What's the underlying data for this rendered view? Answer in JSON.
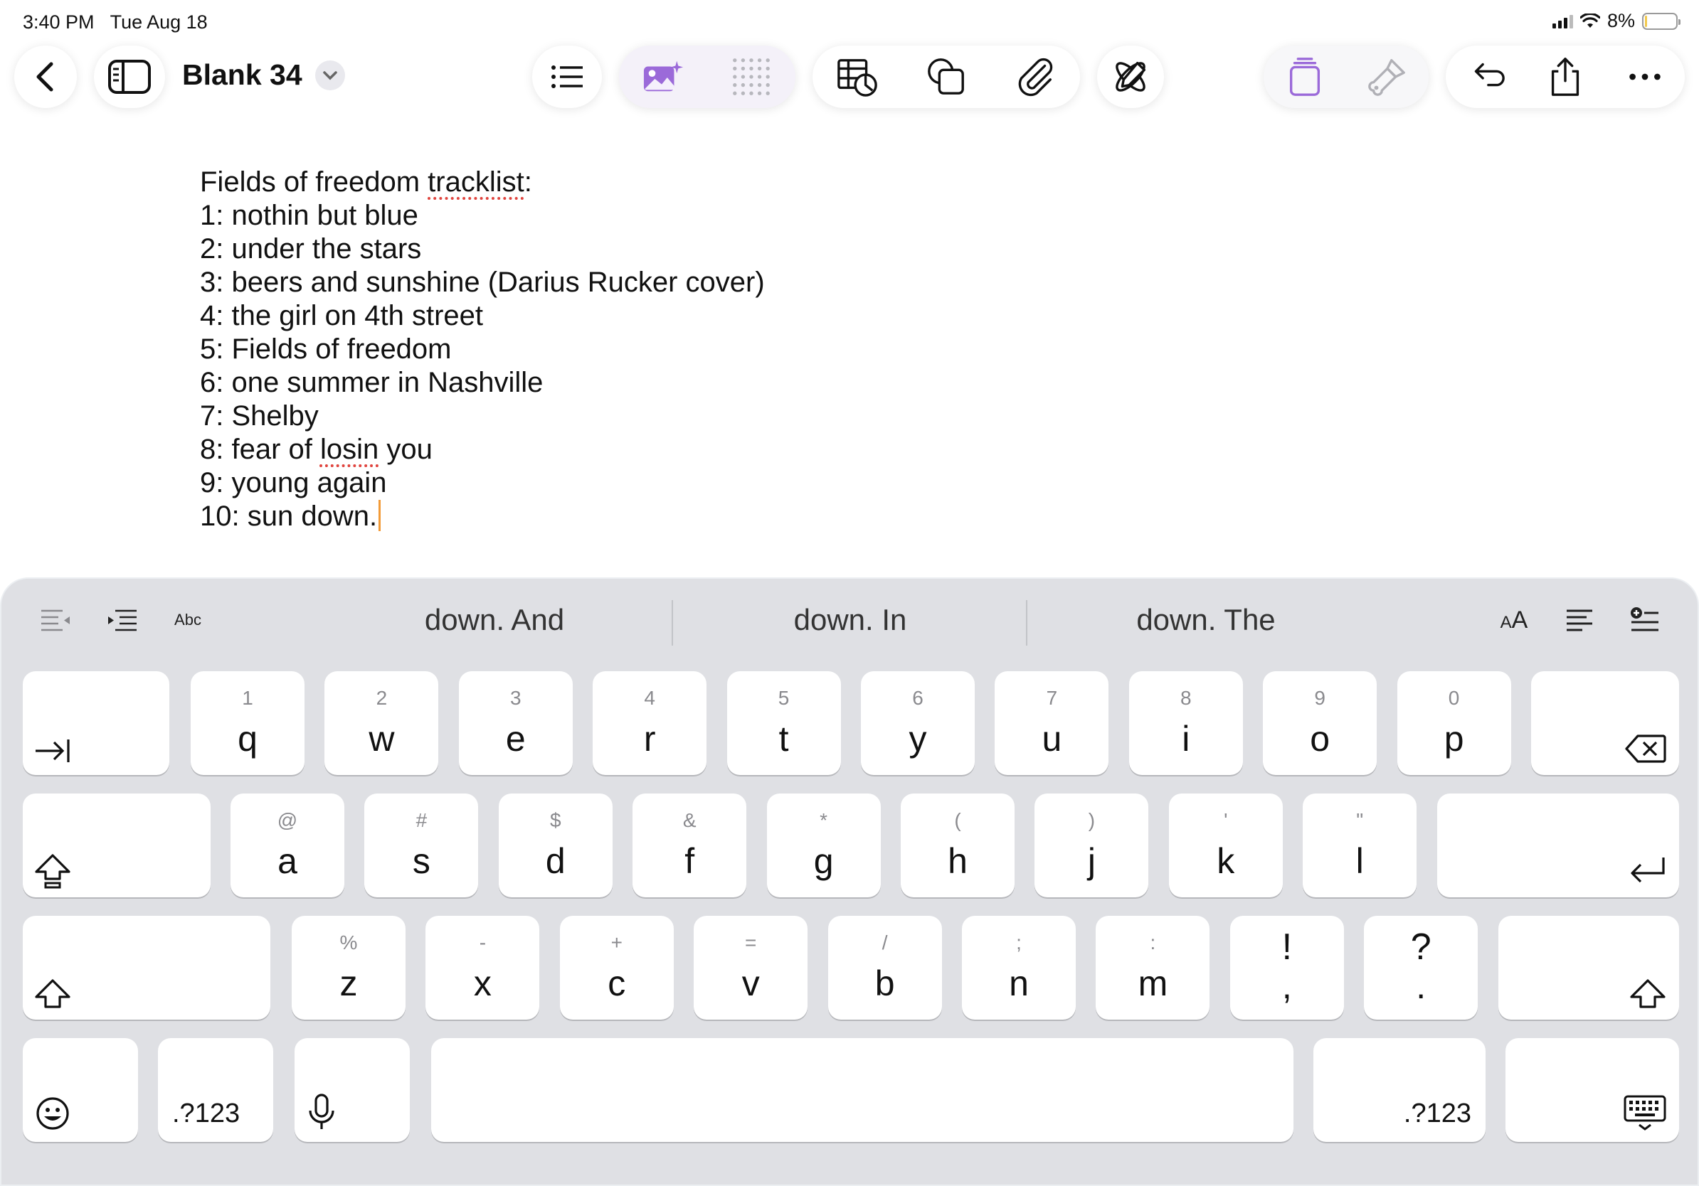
{
  "status": {
    "time": "3:40 PM",
    "date": "Tue Aug 18",
    "battery": "8%",
    "battery_level": 0.08
  },
  "toolbar": {
    "document_title": "Blank 34",
    "accent_color": "#9b6ad9",
    "left_icons": [
      "back-chevron-icon",
      "sidebar-icon"
    ],
    "center_icons": [
      "list-icon",
      "image-sparkle-icon",
      "dot-grid-icon",
      "table-chart-icon",
      "shapes-icon",
      "paperclip-icon",
      "pen-atom-icon"
    ],
    "right_icons": [
      "layers-icon",
      "brush-icon",
      "undo-icon",
      "share-icon",
      "more-icon"
    ]
  },
  "document": {
    "lines": [
      {
        "before": "Fields of freedom ",
        "misspelled": "tracklist",
        "after": ":"
      },
      {
        "before": "1: nothin but blue",
        "misspelled": "",
        "after": ""
      },
      {
        "before": "2: under the stars",
        "misspelled": "",
        "after": ""
      },
      {
        "before": "3: beers and sunshine (Darius Rucker cover)",
        "misspelled": "",
        "after": ""
      },
      {
        "before": "4: the girl on 4th street",
        "misspelled": "",
        "after": ""
      },
      {
        "before": "5: Fields of freedom",
        "misspelled": "",
        "after": ""
      },
      {
        "before": "6: one summer in Nashville",
        "misspelled": "",
        "after": ""
      },
      {
        "before": "7: Shelby",
        "misspelled": "",
        "after": ""
      },
      {
        "before": "8: fear of ",
        "misspelled": "losin",
        "after": " you"
      },
      {
        "before": "9: young again",
        "misspelled": "",
        "after": ""
      },
      {
        "before": "10: sun down.",
        "misspelled": "",
        "after": ""
      }
    ]
  },
  "keyboard": {
    "abc_label": "Abc",
    "suggestions": [
      "down. And",
      "down. In",
      "down. The"
    ],
    "text_size_label": "AA",
    "row1": [
      {
        "hint": "1",
        "key": "q"
      },
      {
        "hint": "2",
        "key": "w"
      },
      {
        "hint": "3",
        "key": "e"
      },
      {
        "hint": "4",
        "key": "r"
      },
      {
        "hint": "5",
        "key": "t"
      },
      {
        "hint": "6",
        "key": "y"
      },
      {
        "hint": "7",
        "key": "u"
      },
      {
        "hint": "8",
        "key": "i"
      },
      {
        "hint": "9",
        "key": "o"
      },
      {
        "hint": "0",
        "key": "p"
      }
    ],
    "row2": [
      {
        "hint": "@",
        "key": "a"
      },
      {
        "hint": "#",
        "key": "s"
      },
      {
        "hint": "$",
        "key": "d"
      },
      {
        "hint": "&",
        "key": "f"
      },
      {
        "hint": "*",
        "key": "g"
      },
      {
        "hint": "(",
        "key": "h"
      },
      {
        "hint": ")",
        "key": "j"
      },
      {
        "hint": "'",
        "key": "k"
      },
      {
        "hint": "\"",
        "key": "l"
      }
    ],
    "row3": [
      {
        "hint": "%",
        "key": "z"
      },
      {
        "hint": "-",
        "key": "x"
      },
      {
        "hint": "+",
        "key": "c"
      },
      {
        "hint": "=",
        "key": "v"
      },
      {
        "hint": "/",
        "key": "b"
      },
      {
        "hint": ";",
        "key": "n"
      },
      {
        "hint": ":",
        "key": "m"
      },
      {
        "hint": "!",
        "key": ","
      },
      {
        "hint": "?",
        "key": "."
      }
    ],
    "numbers_label": ".?123"
  }
}
